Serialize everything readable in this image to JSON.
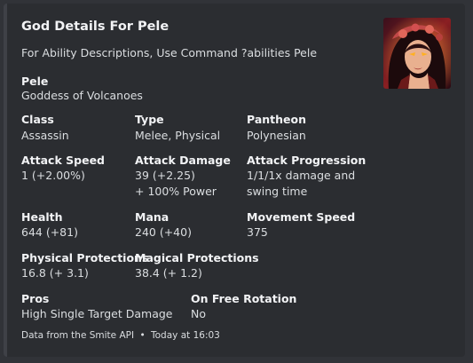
{
  "embed": {
    "accent_color": "#3f4147",
    "title": "God Details For Pele",
    "description": "For Ability Descriptions, Use Command ?abilities Pele",
    "thumbnail": "pele-portrait",
    "fields": {
      "god": {
        "name": "Pele",
        "value": "Goddess of Volcanoes"
      },
      "class": {
        "name": "Class",
        "value": "Assassin"
      },
      "type": {
        "name": "Type",
        "value": "Melee, Physical"
      },
      "pantheon": {
        "name": "Pantheon",
        "value": "Polynesian"
      },
      "attack_speed": {
        "name": "Attack Speed",
        "value": "1 (+2.00%)"
      },
      "attack_damage": {
        "name": "Attack Damage",
        "value_line1": "39 (+2.25)",
        "value_line2": "+ 100% Power"
      },
      "attack_progression": {
        "name": "Attack Progression",
        "value_line1": "1/1/1x damage and",
        "value_line2": "swing time"
      },
      "health": {
        "name": "Health",
        "value": "644 (+81)"
      },
      "mana": {
        "name": "Mana",
        "value": "240 (+40)"
      },
      "movement_speed": {
        "name": "Movement Speed",
        "value": "375"
      },
      "physical_protections": {
        "name": "Physical Protections",
        "value": "16.8 (+ 3.1)"
      },
      "magical_protections": {
        "name": "Magical Protections",
        "value": "38.4 (+ 1.2)"
      },
      "pros": {
        "name": "Pros",
        "value": "High Single Target Damage"
      },
      "free_rotation": {
        "name": "On Free Rotation",
        "value": "No"
      }
    },
    "footer": {
      "source": "Data from the Smite API",
      "separator": "•",
      "timestamp": "Today at 16:03"
    }
  }
}
